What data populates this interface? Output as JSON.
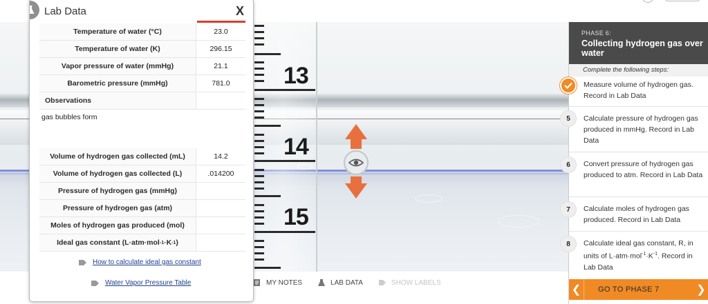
{
  "modal": {
    "title": "Lab Data",
    "close_label": "X",
    "rows_top": [
      {
        "label": "Temperature of water (°C)",
        "value": "23.0"
      },
      {
        "label": "Temperature of water (K)",
        "value": "296.15"
      },
      {
        "label": "Vapor pressure of water (mmHg)",
        "value": "21.1"
      },
      {
        "label": "Barometric pressure (mmHg)",
        "value": "781.0"
      }
    ],
    "observations_label": "Observations",
    "observations_text": "gas bubbles form",
    "rows_bottom": [
      {
        "label": "Volume of hydrogen gas collected (mL)",
        "value": "14.2"
      },
      {
        "label": "Volume of hydrogen gas collected (L)",
        "value": ".014200"
      },
      {
        "label": "Pressure of hydrogen gas (mmHg)",
        "value": ""
      },
      {
        "label": "Pressure of hydrogen gas (atm)",
        "value": ""
      },
      {
        "label": "Moles of hydrogen gas produced (mol)",
        "value": ""
      }
    ],
    "ideal_gas_label_prefix": "Ideal gas constant (L·atm·mol",
    "ideal_gas_sup1": "-1",
    "ideal_gas_mid": "·K",
    "ideal_gas_sup2": "-1",
    "ideal_gas_suffix": ")",
    "ideal_gas_value": "",
    "link_ideal_gas": "How to calculate ideal gas constant",
    "link_vapor_table": "Water Vapor Pressure Table"
  },
  "ruler": {
    "labels": [
      "13",
      "14",
      "15"
    ]
  },
  "toolbar": {
    "my_notes": "MY NOTES",
    "lab_data": "LAB DATA",
    "show_labels": "SHOW LABELS"
  },
  "panel": {
    "phase_number": "PHASE 6:",
    "phase_title": "Collecting hydrogen gas over water",
    "steps_header": "Complete the following steps:",
    "steps": [
      {
        "badge": "",
        "done": true,
        "text": "Measure volume of hydrogen gas. Record in Lab Data"
      },
      {
        "badge": "5",
        "done": false,
        "text": "Calculate pressure of hydrogen gas produced in mmHg. Record in Lab Data"
      },
      {
        "badge": "6",
        "done": false,
        "text": "Convert pressure of hydrogen gas produced to atm. Record in Lab Data"
      },
      {
        "badge": "7",
        "done": false,
        "text": "Calculate moles of hydrogen gas produced. Record in Lab Data"
      }
    ],
    "step8": {
      "badge": "8",
      "text_prefix": "Calculate ideal gas constant, R, in units of L·atm·mol",
      "sup1": "-1",
      "mid": "·K",
      "sup2": "-1",
      "suffix": ". Record in Lab Data"
    },
    "next_button": "GO TO PHASE 7"
  },
  "colors": {
    "accent_orange": "#f08a24",
    "arrow_orange": "#e8703f",
    "phase_header_bg": "#4a4a4a",
    "link_blue": "#1d3f8e",
    "water_line": "#6a7bd6"
  }
}
